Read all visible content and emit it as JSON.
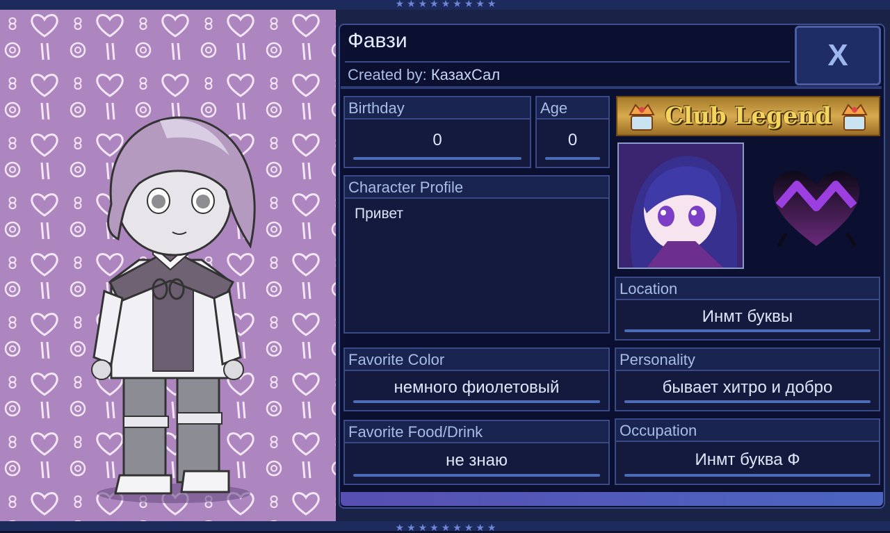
{
  "character": {
    "name": "Фавзи",
    "created_by_label": "Created by:",
    "created_by": "КазахСал"
  },
  "close_label": "X",
  "fields": {
    "birthday": {
      "label": "Birthday",
      "value": "0"
    },
    "age": {
      "label": "Age",
      "value": "0"
    },
    "profile": {
      "label": "Character Profile",
      "value": "Привет"
    },
    "location": {
      "label": "Location",
      "value": "Инмт буквы"
    },
    "favorite_color": {
      "label": "Favorite Color",
      "value": "немного фиолетовый"
    },
    "personality": {
      "label": "Personality",
      "value": "бывает хитро и добро"
    },
    "favorite_food": {
      "label": "Favorite Food/Drink",
      "value": "не знаю"
    },
    "occupation": {
      "label": "Occupation",
      "value": "Инмт буква Ф"
    }
  },
  "banner": {
    "text": "Club Legend"
  },
  "colors": {
    "background_pattern": "#ad85bf",
    "panel": "#0b1030",
    "accent": "#4d6cb6",
    "heart": "#8a3fd0"
  }
}
